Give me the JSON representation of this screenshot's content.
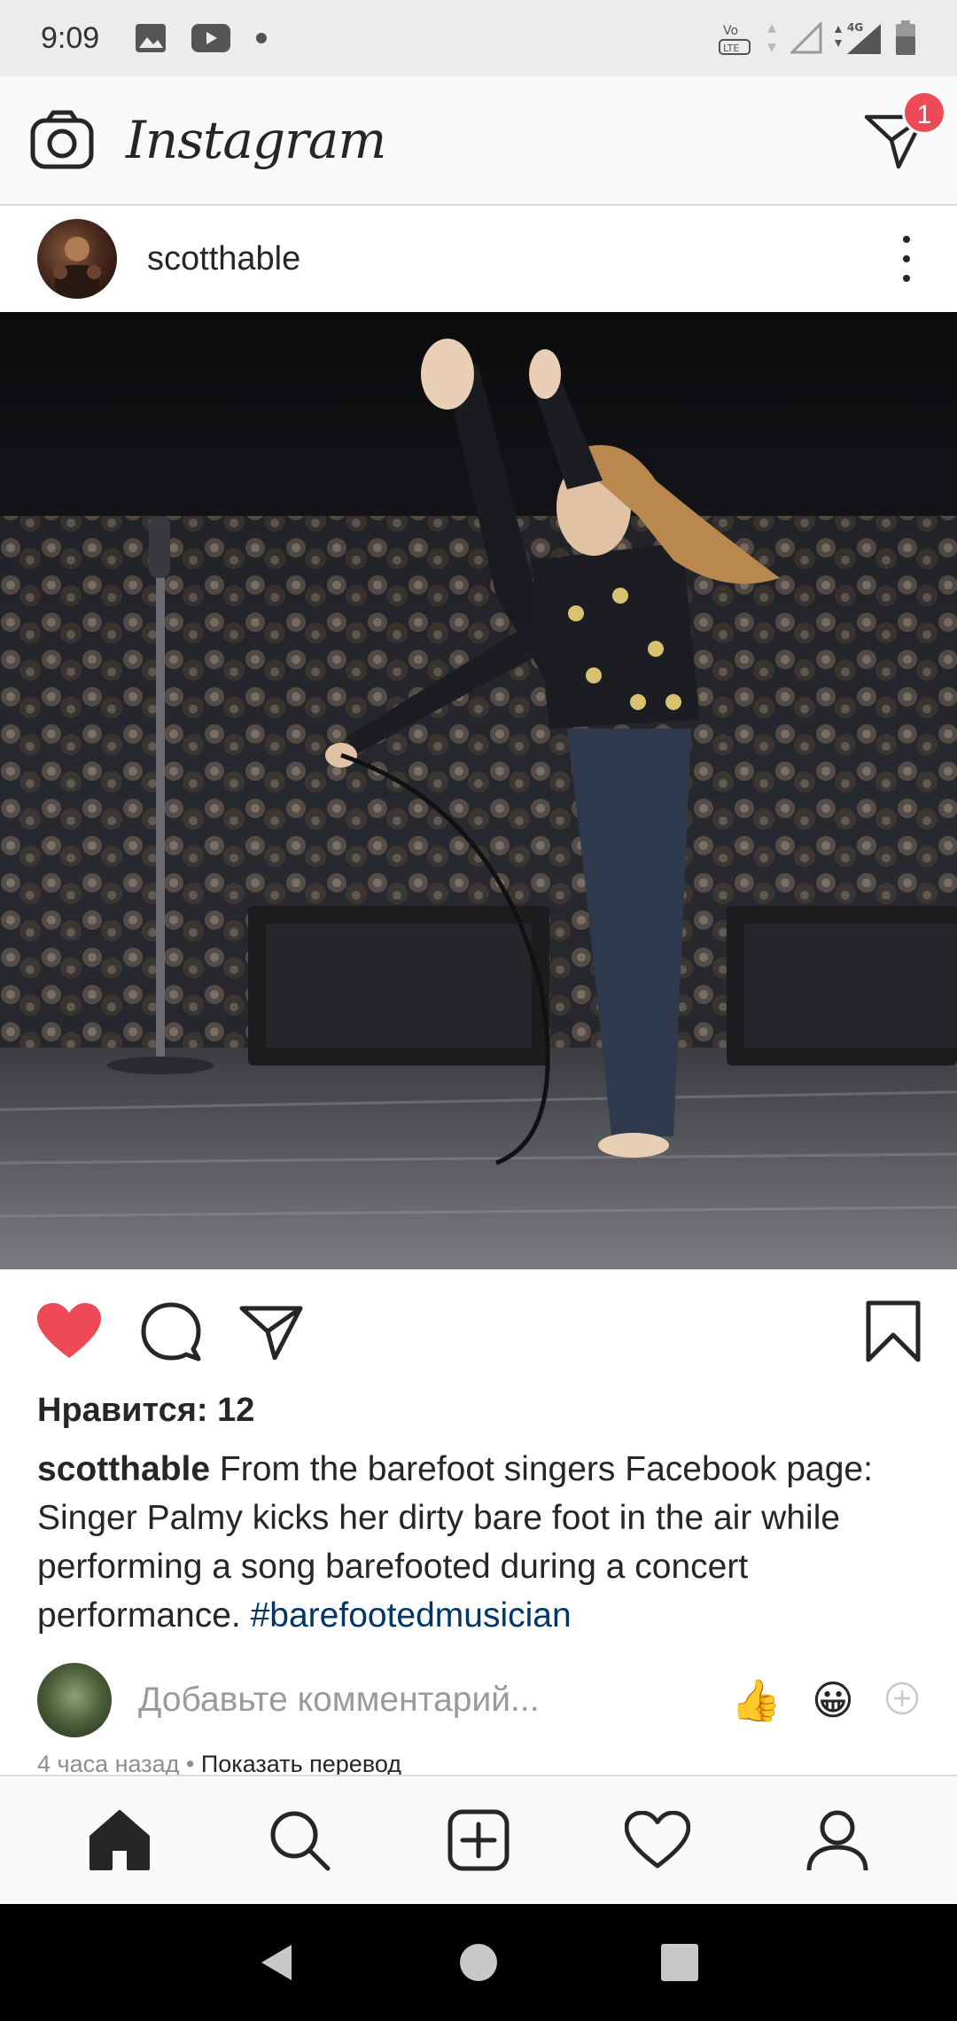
{
  "status_bar": {
    "time": "9:09",
    "network": "4G",
    "volte": "Vo LTE"
  },
  "header": {
    "app_name": "Instagram",
    "dm_badge": "1"
  },
  "post": {
    "username": "scotthable",
    "likes": "Нравится: 12",
    "caption_user": "scotthable",
    "caption_text": " From the barefoot singers Facebook page: Singer Palmy kicks her dirty bare foot in the air while performing a song barefooted during a concert performance. ",
    "hashtag": "#barefootedmusician",
    "comment_placeholder": "Добавьте комментарий...",
    "quick_emoji_1": "👍",
    "quick_emoji_2": "😀",
    "time_ago": "4 часа назад",
    "separator": " • ",
    "show_translation": "Показать перевод",
    "liked": true
  },
  "colors": {
    "like_red": "#ed4956",
    "hashtag_blue": "#003569",
    "badge_red": "#ed4956"
  }
}
